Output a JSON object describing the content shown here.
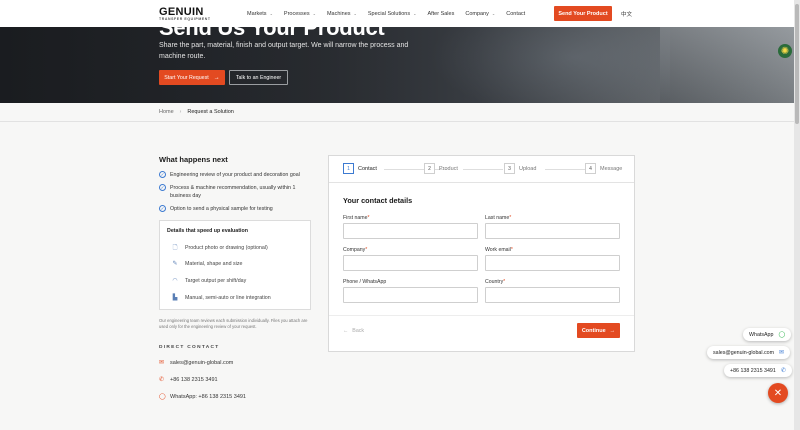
{
  "header": {
    "logo_brand": "GENUIN",
    "logo_tagline": "TRANSFER EQUIPMENT",
    "nav": [
      {
        "label": "Markets",
        "dropdown": true
      },
      {
        "label": "Processes",
        "dropdown": true
      },
      {
        "label": "Machines",
        "dropdown": true
      },
      {
        "label": "Special Solutions",
        "dropdown": true
      },
      {
        "label": "After Sales",
        "dropdown": false
      },
      {
        "label": "Company",
        "dropdown": true
      },
      {
        "label": "Contact",
        "dropdown": false
      }
    ],
    "cta_label": "Send Your Product",
    "language": "中文"
  },
  "hero": {
    "title": "Send Us Your Product",
    "subtitle": "Share the part, material, finish and output target. We will narrow the process and machine route.",
    "primary_button": "Start Your Request",
    "secondary_button": "Talk to an Engineer"
  },
  "breadcrumb": {
    "home": "Home",
    "separator": "›",
    "current": "Request a Solution"
  },
  "what_next": {
    "title": "What happens next",
    "items": [
      "Engineering review of your product and decoration goal",
      "Process & machine recommendation, usually within 1 business day",
      "Option to send a physical sample for testing"
    ]
  },
  "details": {
    "title": "Details that speed up evaluation",
    "items": [
      {
        "label": "Product photo or drawing (optional)",
        "icon": "document-icon"
      },
      {
        "label": "Material, shape and size",
        "icon": "ruler-icon"
      },
      {
        "label": "Target output per shift/day",
        "icon": "gauge-icon"
      },
      {
        "label": "Manual, semi-auto or line integration",
        "icon": "factory-icon"
      }
    ]
  },
  "note": "Our engineering team reviews each submission individually. Files you attach are used only for the engineering review of your request.",
  "direct_contact": {
    "label": "DIRECT CONTACT",
    "email": "sales@genuin-global.com",
    "phone": "+86 138 2315 3491",
    "whatsapp": "WhatsApp: +86 138 2315 3491"
  },
  "form": {
    "steps": [
      {
        "num": "1",
        "label": "Contact",
        "active": true
      },
      {
        "num": "2",
        "label": "Product",
        "active": false
      },
      {
        "num": "3",
        "label": "Upload",
        "active": false
      },
      {
        "num": "4",
        "label": "Message",
        "active": false
      }
    ],
    "title": "Your contact details",
    "fields": {
      "first_name": {
        "label": "First name",
        "required": "*",
        "value": ""
      },
      "last_name": {
        "label": "Last name",
        "required": "*",
        "value": ""
      },
      "company": {
        "label": "Company",
        "required": "*",
        "value": ""
      },
      "work_email": {
        "label": "Work email",
        "required": "*",
        "value": ""
      },
      "phone": {
        "label": "Phone / WhatsApp",
        "required": "",
        "value": ""
      },
      "country": {
        "label": "Country",
        "required": "*",
        "value": ""
      }
    },
    "back_label": "Back",
    "continue_label": "Continue"
  },
  "floating": {
    "whatsapp": "WhatsApp",
    "email": "sales@genuin-global.com",
    "phone": "+86 138 2315 3491"
  },
  "colors": {
    "accent": "#e34a21",
    "link_blue": "#3c7ad1"
  }
}
